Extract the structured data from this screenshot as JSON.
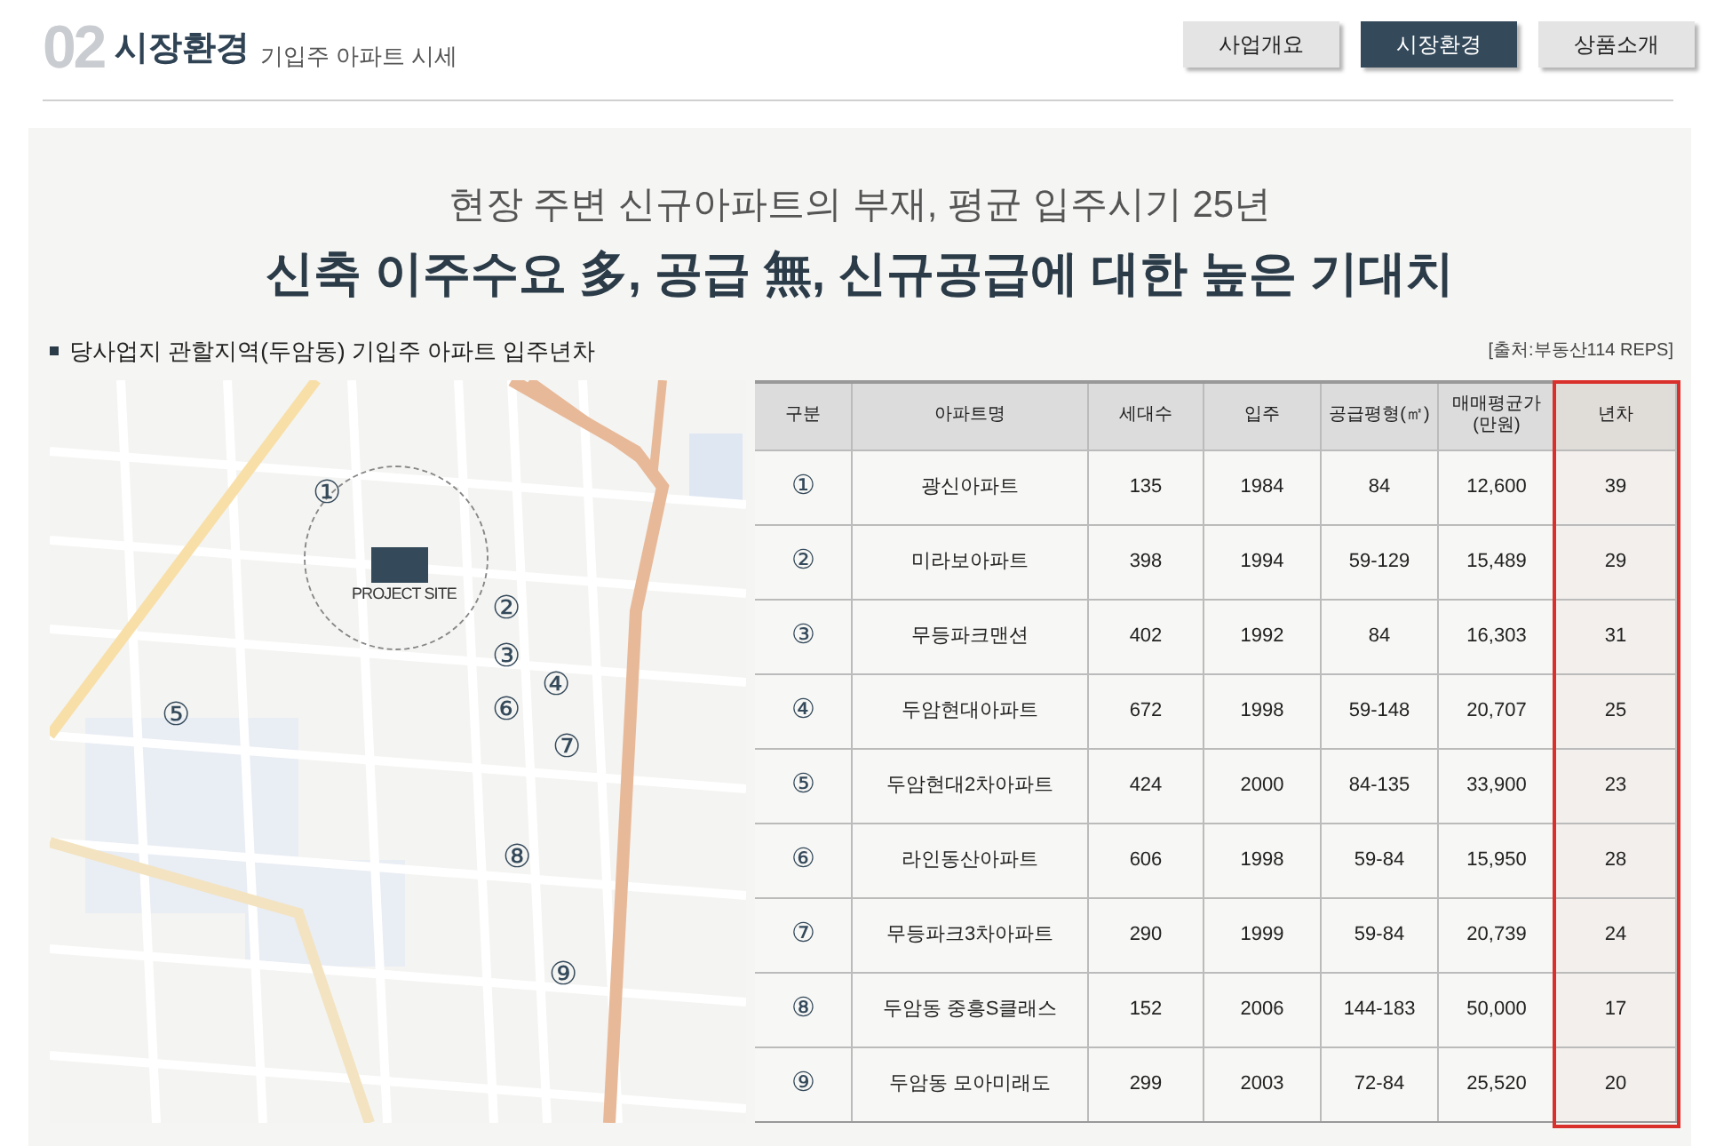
{
  "header": {
    "number": "02",
    "title": "시장환경",
    "subtitle": "기입주 아파트 시세"
  },
  "nav_tabs": [
    {
      "label": "사업개요",
      "selected": false
    },
    {
      "label": "시장환경",
      "selected": true
    },
    {
      "label": "상품소개",
      "selected": false
    }
  ],
  "headline": {
    "line_1": "현장 주변 신규아파트의 부재, 평균 입주시기 25년",
    "line_2": "신축 이주수요 多, 공급 無, 신규공급에 대한 높은 기대치"
  },
  "section_title": "당사업지 관할지역(두암동) 기입주 아파트 입주년차",
  "source": "[출처:부동산114 REPS]",
  "map": {
    "site_label": "PROJECT SITE",
    "markers": [
      "①",
      "②",
      "③",
      "④",
      "⑤",
      "⑥",
      "⑦",
      "⑧",
      "⑨"
    ]
  },
  "table": {
    "columns": [
      {
        "label": "구분",
        "highlighted": false
      },
      {
        "label": "아파트명",
        "highlighted": false
      },
      {
        "label": "세대수",
        "highlighted": false
      },
      {
        "label": "입주",
        "highlighted": false
      },
      {
        "label": "공급평형(㎡)",
        "highlighted": false
      },
      {
        "label": "매매평균가\n(만원)",
        "highlighted": false
      },
      {
        "label": "년차",
        "highlighted": true
      }
    ],
    "rows": [
      [
        "①",
        "광신아파트",
        "135",
        "1984",
        "84",
        "12,600",
        "39"
      ],
      [
        "②",
        "미라보아파트",
        "398",
        "1994",
        "59-129",
        "15,489",
        "29"
      ],
      [
        "③",
        "무등파크맨션",
        "402",
        "1992",
        "84",
        "16,303",
        "31"
      ],
      [
        "④",
        "두암현대아파트",
        "672",
        "1998",
        "59-148",
        "20,707",
        "25"
      ],
      [
        "⑤",
        "두암현대2차아파트",
        "424",
        "2000",
        "84-135",
        "33,900",
        "23"
      ],
      [
        "⑥",
        "라인동산아파트",
        "606",
        "1998",
        "59-84",
        "15,950",
        "28"
      ],
      [
        "⑦",
        "무등파크3차아파트",
        "290",
        "1999",
        "59-84",
        "20,739",
        "24"
      ],
      [
        "⑧",
        "두암동 중흥S클래스",
        "152",
        "2006",
        "144-183",
        "50,000",
        "17"
      ],
      [
        "⑨",
        "두암동 모아미래도",
        "299",
        "2003",
        "72-84",
        "25,520",
        "20"
      ]
    ]
  }
}
